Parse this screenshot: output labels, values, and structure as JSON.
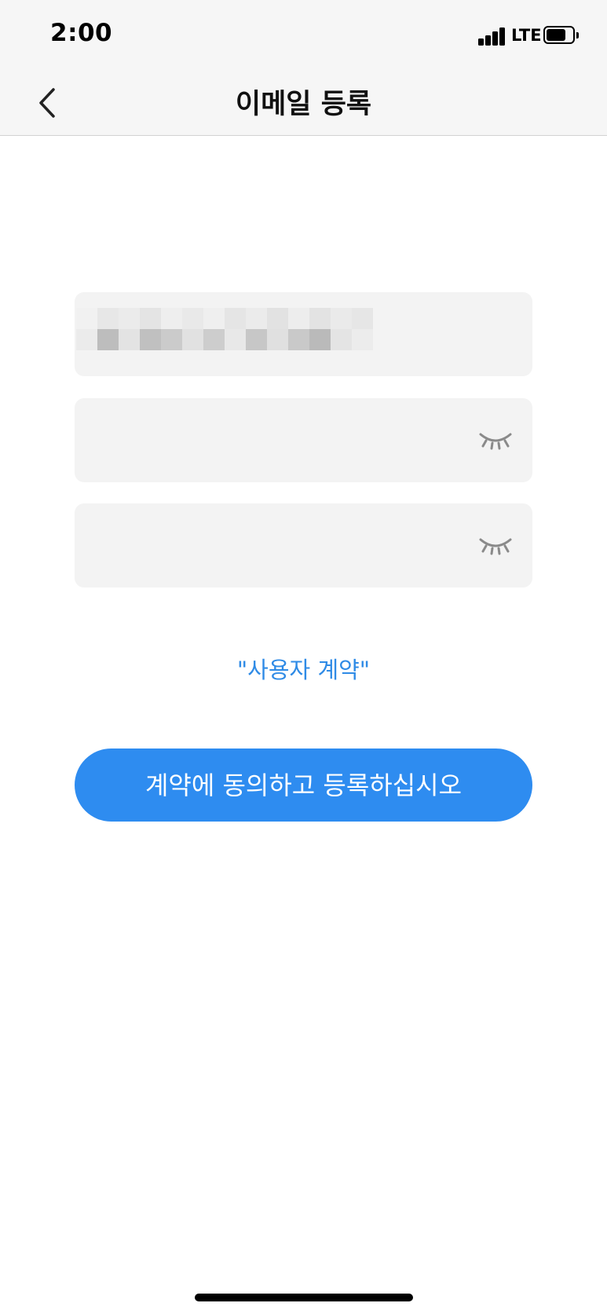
{
  "status_bar": {
    "time": "2:00",
    "network": "LTE",
    "battery_level": 0.75,
    "signal_bars": 4
  },
  "nav": {
    "title": "이메일 등록",
    "back_icon": "chevron-left-icon"
  },
  "form": {
    "email_value_obscured": true,
    "password_toggle_icon": "eye-closed-icon",
    "confirm_toggle_icon": "eye-closed-icon"
  },
  "agreement": {
    "link_text": "\"사용자 계약\""
  },
  "submit": {
    "label": "계약에 동의하고 등록하십시오"
  },
  "colors": {
    "accent": "#2e8cf0",
    "link": "#2f8be6",
    "field_bg": "#f3f3f3",
    "nav_bg": "#f6f6f6"
  }
}
